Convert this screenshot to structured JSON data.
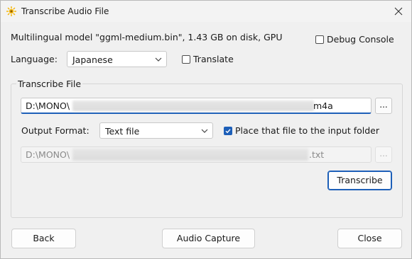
{
  "window": {
    "title": "Transcribe Audio File"
  },
  "info": {
    "model_text": "Multilingual model \"ggml-medium.bin\", 1.43 GB on disk, GPU"
  },
  "debug_console": {
    "label": "Debug Console",
    "checked": false
  },
  "language": {
    "label": "Language:",
    "value": "Japanese"
  },
  "translate": {
    "label": "Translate",
    "checked": false
  },
  "transcribe_file": {
    "group_title": "Transcribe File",
    "input_path_start": "D:\\MONO\\",
    "input_path_end": "m4a",
    "browse_label": "..."
  },
  "output_format": {
    "label": "Output Format:",
    "value": "Text file"
  },
  "place_in_input_folder": {
    "label": "Place that file to the input folder",
    "checked": true
  },
  "output_file": {
    "path_start": "D:\\MONO\\",
    "path_end": ".txt",
    "browse_label": "..."
  },
  "buttons": {
    "transcribe": "Transcribe",
    "back": "Back",
    "audio_capture": "Audio Capture",
    "close": "Close"
  },
  "colors": {
    "accent": "#1d5fb8",
    "icon": "#f5b400"
  }
}
